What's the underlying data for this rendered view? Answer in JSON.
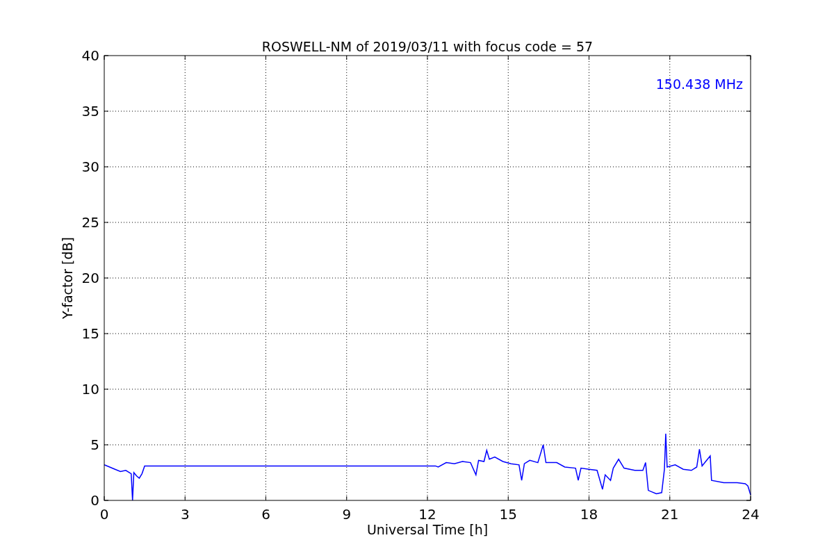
{
  "figure": {
    "chart_data": {
      "type": "line",
      "title": "ROSWELL-NM of 2019/03/11 with focus code = 57",
      "xlabel": "Universal Time [h]",
      "ylabel": "Y-factor [dB]",
      "x": [
        0,
        0.2,
        0.4,
        0.6,
        0.8,
        1.0,
        1.05,
        1.1,
        1.2,
        1.3,
        1.4,
        1.5,
        12.3,
        12.4,
        12.7,
        13.0,
        13.3,
        13.6,
        13.8,
        13.9,
        14.1,
        14.2,
        14.3,
        14.5,
        14.8,
        15.1,
        15.4,
        15.5,
        15.6,
        15.8,
        16.1,
        16.3,
        16.4,
        16.8,
        17.1,
        17.5,
        17.6,
        17.7,
        18.0,
        18.3,
        18.5,
        18.6,
        18.8,
        18.9,
        19.1,
        19.3,
        19.7,
        20.0,
        20.1,
        20.2,
        20.5,
        20.7,
        20.8,
        20.85,
        20.9,
        21.2,
        21.5,
        21.8,
        22.0,
        22.1,
        22.2,
        22.5,
        22.55,
        23.0,
        23.5,
        23.8,
        23.9,
        24.0
      ],
      "series": [
        {
          "color": "#0000ff",
          "values": [
            3.2,
            3.0,
            2.8,
            2.6,
            2.7,
            2.4,
            0.0,
            2.5,
            2.2,
            2.0,
            2.4,
            3.1,
            3.1,
            3.0,
            3.4,
            3.3,
            3.5,
            3.4,
            2.3,
            3.6,
            3.5,
            4.5,
            3.7,
            3.9,
            3.5,
            3.3,
            3.2,
            1.8,
            3.3,
            3.6,
            3.4,
            5.0,
            3.4,
            3.4,
            3.0,
            2.9,
            1.8,
            2.9,
            2.8,
            2.7,
            1.0,
            2.3,
            1.8,
            2.9,
            3.7,
            2.9,
            2.7,
            2.7,
            3.4,
            0.9,
            0.6,
            0.7,
            2.8,
            6.0,
            3.0,
            3.2,
            2.8,
            2.7,
            3.0,
            4.6,
            3.1,
            4.0,
            1.8,
            1.6,
            1.6,
            1.5,
            1.3,
            0.5
          ]
        }
      ],
      "xlim": [
        0,
        24
      ],
      "ylim": [
        0,
        40
      ],
      "xticks": [
        0,
        3,
        6,
        9,
        12,
        15,
        18,
        21,
        24
      ],
      "yticks": [
        0,
        5,
        10,
        15,
        20,
        25,
        30,
        35,
        40
      ],
      "grid": true,
      "annotations": [
        "150.438 MHz"
      ]
    }
  }
}
